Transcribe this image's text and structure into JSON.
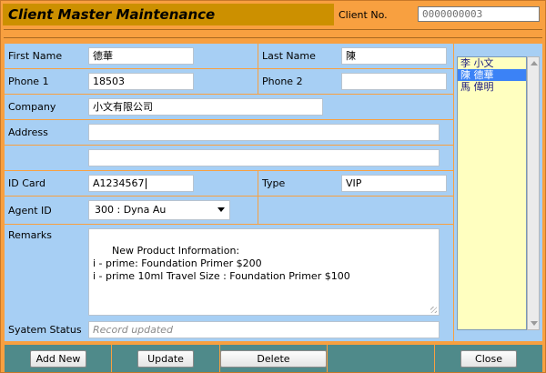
{
  "header": {
    "title": "Client Master Maintenance",
    "client_no_label": "Client No.",
    "client_no_value": "0000000003"
  },
  "form": {
    "first_name_label": "First Name",
    "first_name_value": "德華",
    "last_name_label": "Last Name",
    "last_name_value": "陳",
    "phone1_label": "Phone 1",
    "phone1_value": "18503",
    "phone2_label": "Phone 2",
    "phone2_value": "",
    "company_label": "Company",
    "company_value": "小文有限公司",
    "address_label": "Address",
    "address_line1": "",
    "address_line2": "",
    "id_card_label": "ID Card",
    "id_card_value": "A1234567",
    "type_label": "Type",
    "type_value": "VIP",
    "agent_id_label": "Agent ID",
    "agent_id_value": "300 : Dyna Au",
    "remarks_label": "Remarks",
    "remarks_value": "New Product Information:\ni - prime: Foundation Primer $200\ni - prime 10ml Travel Size : Foundation Primer $100",
    "status_label": "Syatem Status",
    "status_value": "Record updated"
  },
  "client_list": {
    "items": [
      {
        "label": "李 小文"
      },
      {
        "label": "陳 德華"
      },
      {
        "label": "馬 偉明"
      }
    ],
    "selected_index": 1
  },
  "buttons": {
    "add_new": "Add New",
    "update": "Update",
    "delete": "Delete",
    "close": "Close"
  },
  "colors": {
    "frame": "#f8a040",
    "title_bar": "#cc9000",
    "cell": "#a7cff4",
    "list_bg": "#ffffc0",
    "selection": "#3b82f6",
    "button_bar": "#4f8a8a"
  }
}
